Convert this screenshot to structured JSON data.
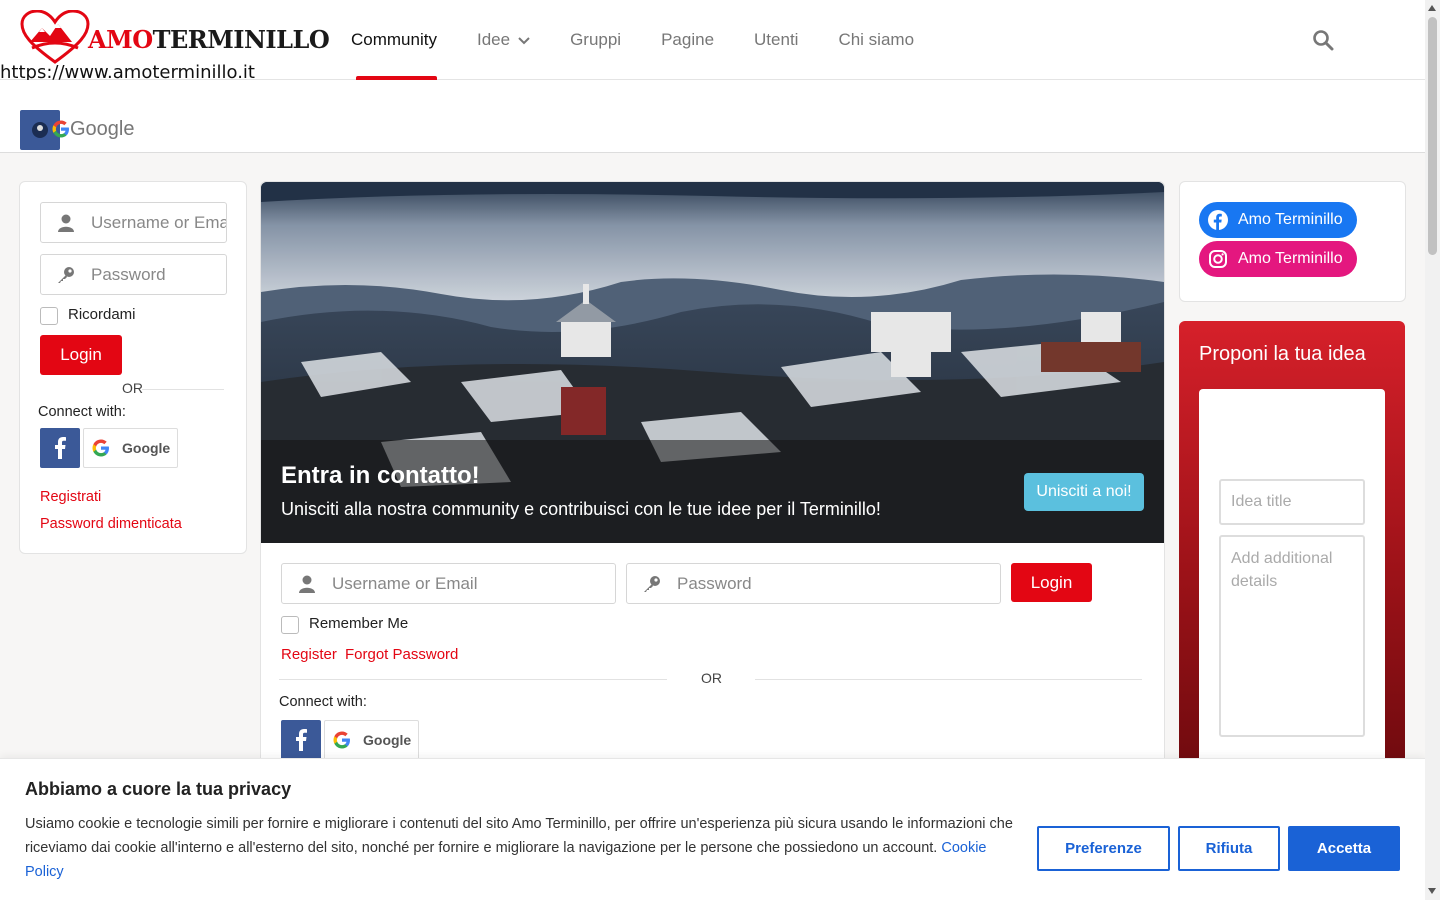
{
  "site": {
    "logo_text_red": "AMO",
    "logo_text_dark": "TERMINILLO",
    "url": "https://www.amoterminillo.it"
  },
  "nav": {
    "items": [
      {
        "label": "Community",
        "active": true
      },
      {
        "label": "Idee",
        "dropdown": true
      },
      {
        "label": "Gruppi"
      },
      {
        "label": "Pagine"
      },
      {
        "label": "Utenti"
      },
      {
        "label": "Chi siamo"
      }
    ],
    "search_icon": "search-icon"
  },
  "subbar": {
    "label": "Google"
  },
  "sidebar_login": {
    "username_placeholder": "Username or Email",
    "password_placeholder": "Password",
    "remember_label": "Ricordami",
    "login_label": "Login",
    "or_label": "OR",
    "connect_label": "Connect with:",
    "google_label": "Google",
    "register_link": "Registrati",
    "forgot_link": "Password dimenticata"
  },
  "hero": {
    "title": "Entra in contatto!",
    "subtitle": "Unisciti alla nostra community e contribuisci con le tue idee per il Terminillo!",
    "cta_label": "Unisciti a noi!"
  },
  "main_login": {
    "username_placeholder": "Username or Email",
    "password_placeholder": "Password",
    "login_label": "Login",
    "remember_label": "Remember Me",
    "register_link": "Register",
    "forgot_link": "Forgot Password",
    "or_label": "OR",
    "connect_label": "Connect with:",
    "google_label": "Google"
  },
  "social": {
    "facebook_label": "Amo Terminillo",
    "instagram_label": "Amo Terminillo",
    "facebook_color": "#1877f2",
    "instagram_color": "#e4177f"
  },
  "idea": {
    "title": "Proponi la tua idea",
    "title_placeholder": "Idea title",
    "details_placeholder": "Add additional details"
  },
  "cookie": {
    "title": "Abbiamo a cuore la tua privacy",
    "text": "Usiamo cookie e tecnologie simili per fornire e migliorare i contenuti del sito Amo Terminillo, per offrire un'esperienza più sicura usando le informazioni che riceviamo dai cookie all'interno e all'esterno del sito, nonché per fornire e migliorare la navigazione per le persone che possiedono un account.",
    "link_label": "Cookie Policy",
    "pref_label": "Preferenze",
    "reject_label": "Rifiuta",
    "accept_label": "Accetta"
  },
  "colors": {
    "accent": "#e30613",
    "cookie_blue": "#1a62d6",
    "hero_button": "#5bc0de"
  }
}
